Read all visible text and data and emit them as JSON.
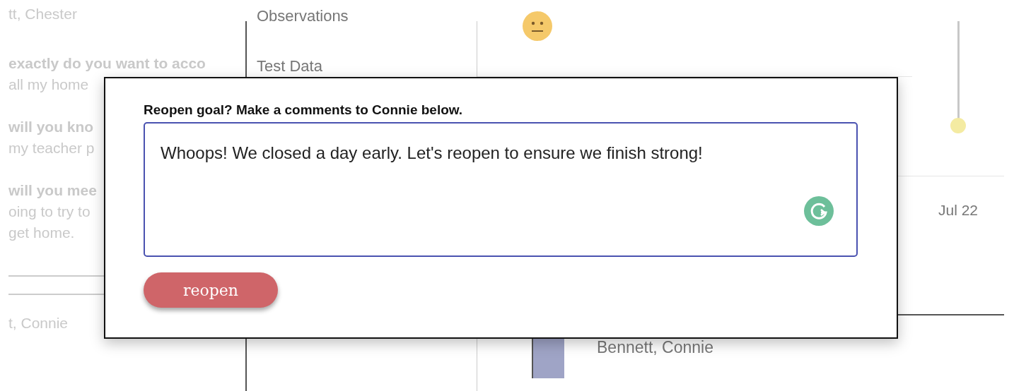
{
  "students_column": {
    "name_top": "tt, Chester",
    "responses": [
      {
        "question": "exactly do you want to acco",
        "answer_lines": [
          "all my home"
        ]
      },
      {
        "question": "will you kno",
        "answer_lines": [
          "my teacher p"
        ]
      },
      {
        "question": "will you mee",
        "answer_lines": [
          "oing to try to",
          "get home."
        ]
      }
    ],
    "name_bottom": "t, Connie"
  },
  "categories": [
    "Observations",
    "Test Data"
  ],
  "timeline": {
    "date": "Jul 22"
  },
  "goal_row": {
    "student": "Bennett, Connie"
  },
  "dialog": {
    "prompt": "Reopen goal? Make a comments to Connie below.",
    "comment": "Whoops! We closed a day early. Let's reopen to ensure we finish strong!",
    "button": "reopen"
  }
}
